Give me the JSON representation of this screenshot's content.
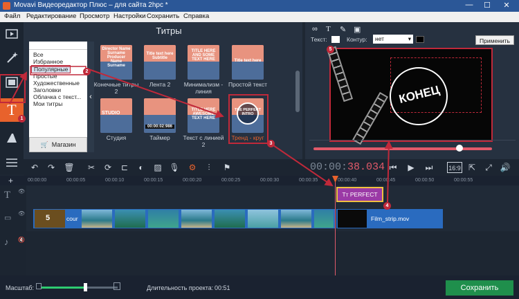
{
  "window": {
    "title": "Movavi Видеоредактор Плюс – для сайта 2hpc *",
    "min": "—",
    "max": "☐",
    "close": "✕"
  },
  "menu": [
    "Файл",
    "Редактирование",
    "Просмотр",
    "Настройки",
    "Сохранить",
    "Справка"
  ],
  "side_tools": [
    "film-icon",
    "magic-wand-icon",
    "filter-icon",
    "titles-icon",
    "transition-icon",
    "list-icon"
  ],
  "titles_panel": {
    "heading": "Титры",
    "categories": [
      "Все",
      "Избранное",
      "Популярные",
      "Простые",
      "Художественные",
      "Заголовки",
      "Облачка с текст...",
      "Мои титры"
    ],
    "selected_category": "Популярные",
    "store_label": "Магазин",
    "tiles": [
      {
        "label": "Конечные титры 2",
        "thumb_text": "Director Name Surname Producer Name Surname"
      },
      {
        "label": "Лента 2",
        "thumb_text": "Title text here Subtitle"
      },
      {
        "label": "Минимализм - линия",
        "thumb_text": "TITLE HERE AND SOME TEXT HERE"
      },
      {
        "label": "Простой текст",
        "thumb_text": "Title text here"
      },
      {
        "label": "Студия",
        "thumb_text": "STUDIO"
      },
      {
        "label": "Таймер",
        "thumb_text": "00:00:02:986"
      },
      {
        "label": "Текст с линией 2",
        "thumb_text": "TITLE HERE AWESOME TEXT HERE"
      },
      {
        "label": "Тренд - круг",
        "thumb_text": "THE PERFECT INTRO"
      }
    ]
  },
  "preview_panel": {
    "format_text_label": "Текст:",
    "outline_label": "Контур:",
    "outline_value": "нет",
    "apply_label": "Применить",
    "screen_text": "КОНЕЦ",
    "playback_progress": 0.85
  },
  "timecode": {
    "prefix": "00:00:",
    "active": "38.034"
  },
  "ruler": [
    "00:00:00",
    "00:00:05",
    "00:00:10",
    "00:00:15",
    "00:00:20",
    "00:00:25",
    "00:00:30",
    "00:00:35",
    "00:00:40",
    "00:00:45",
    "00:00:50",
    "00:00:55"
  ],
  "aspect": "16:9",
  "timeline": {
    "title_clip": "PERFECT",
    "video_clip_1": "cour",
    "video_clip_2": "Film_strip.mov",
    "film_number": "5"
  },
  "status": {
    "zoom_label": "Масштаб:",
    "duration_label": "Длительность проекта:",
    "duration_value": "00:51",
    "zoom_level": 0.58,
    "save_label": "Сохранить"
  },
  "annotations": [
    "1",
    "2",
    "3",
    "4",
    "5"
  ],
  "colors": {
    "accent": "#e8622c",
    "annotation": "#c0293a",
    "title_clip": "#9b3aa6",
    "save": "#1f8f4c",
    "timecode_active": "#e15a6a"
  }
}
